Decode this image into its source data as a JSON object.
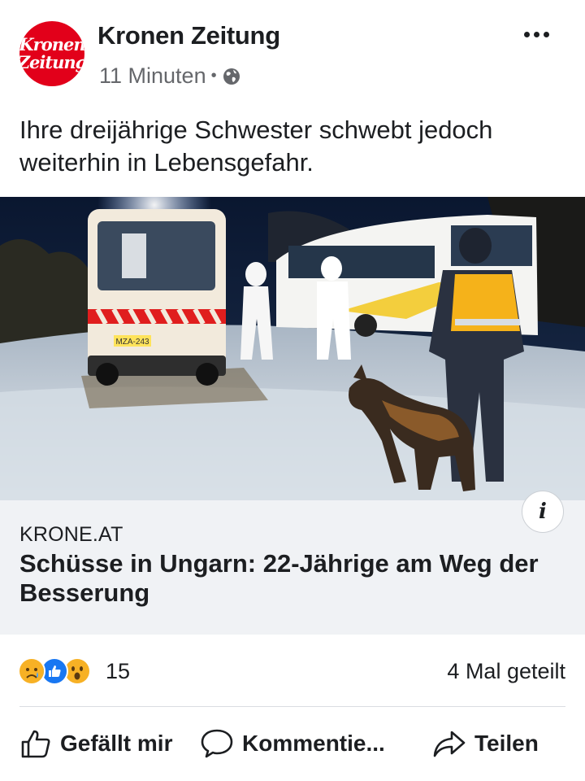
{
  "post": {
    "page_name": "Kronen Zeitung",
    "avatar_text_line1": "Kronen",
    "avatar_text_line2": "Zeitung",
    "timestamp": "11 Minuten",
    "separator": "•",
    "privacy_icon": "globe-icon",
    "text": "Ihre dreijährige Schwester schwebt jedoch weiterhin in Lebensgefahr."
  },
  "link": {
    "domain": "KRONE.AT",
    "title": "Schüsse in Ungarn: 22-Jährige am Weg der Besserung",
    "info_label": "i",
    "image_plate": "MZA-243"
  },
  "reactions": {
    "icons": [
      "sad",
      "like",
      "wow"
    ],
    "count": "15",
    "shares": "4 Mal geteilt"
  },
  "actions": {
    "like": "Gefällt mir",
    "comment": "Kommentie...",
    "share": "Teilen"
  },
  "colors": {
    "brand_red": "#e2001a",
    "like_blue": "#1877f2",
    "reaction_yellow": "#f7b125",
    "secondary_text": "#65676b",
    "card_background": "#f0f2f5"
  }
}
